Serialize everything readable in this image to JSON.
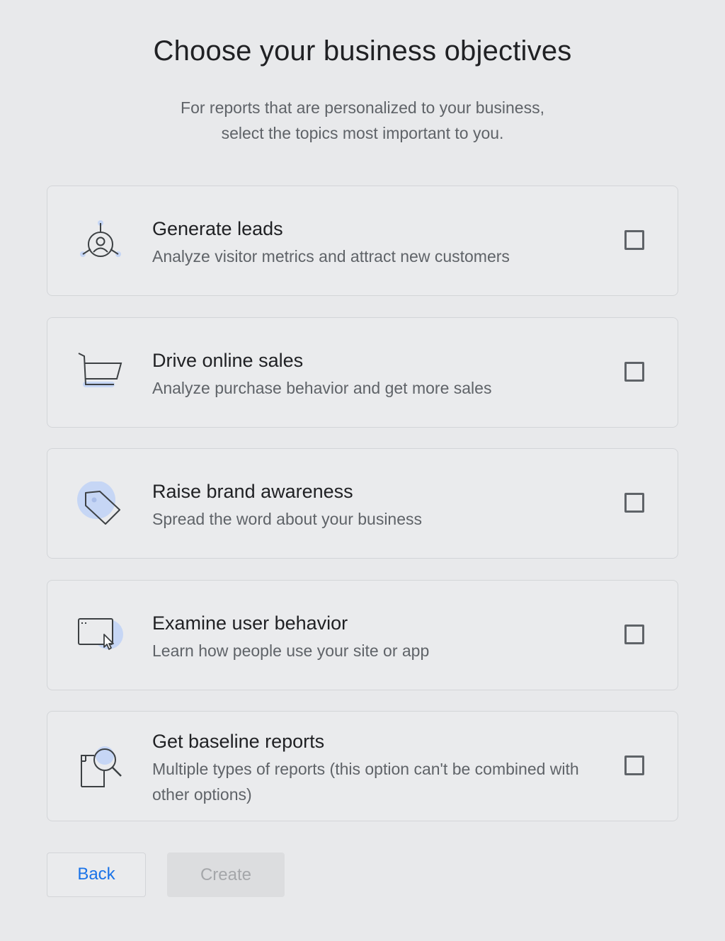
{
  "header": {
    "title": "Choose your business objectives",
    "subtitle_line1": "For reports that are personalized to your business,",
    "subtitle_line2": "select the topics most important to you."
  },
  "options": [
    {
      "icon": "leads-target-person-icon",
      "title": "Generate leads",
      "description": "Analyze visitor metrics and attract new customers",
      "checked": false
    },
    {
      "icon": "shopping-cart-icon",
      "title": "Drive online sales",
      "description": "Analyze purchase behavior and get more sales",
      "checked": false
    },
    {
      "icon": "price-tag-icon",
      "title": "Raise brand awareness",
      "description": "Spread the word about your business",
      "checked": false
    },
    {
      "icon": "browser-cursor-icon",
      "title": "Examine user behavior",
      "description": "Learn how people use your site or app",
      "checked": false
    },
    {
      "icon": "report-magnifier-icon",
      "title": "Get baseline reports",
      "description": "Multiple types of reports (this option can't be combined with other options)",
      "checked": false
    }
  ],
  "footer": {
    "back_label": "Back",
    "create_label": "Create",
    "create_enabled": false
  },
  "colors": {
    "background": "#e8e9eb",
    "accent": "#1a73e8",
    "icon_highlight": "#c6d6f5",
    "text_primary": "#202124",
    "text_secondary": "#5f6368"
  }
}
